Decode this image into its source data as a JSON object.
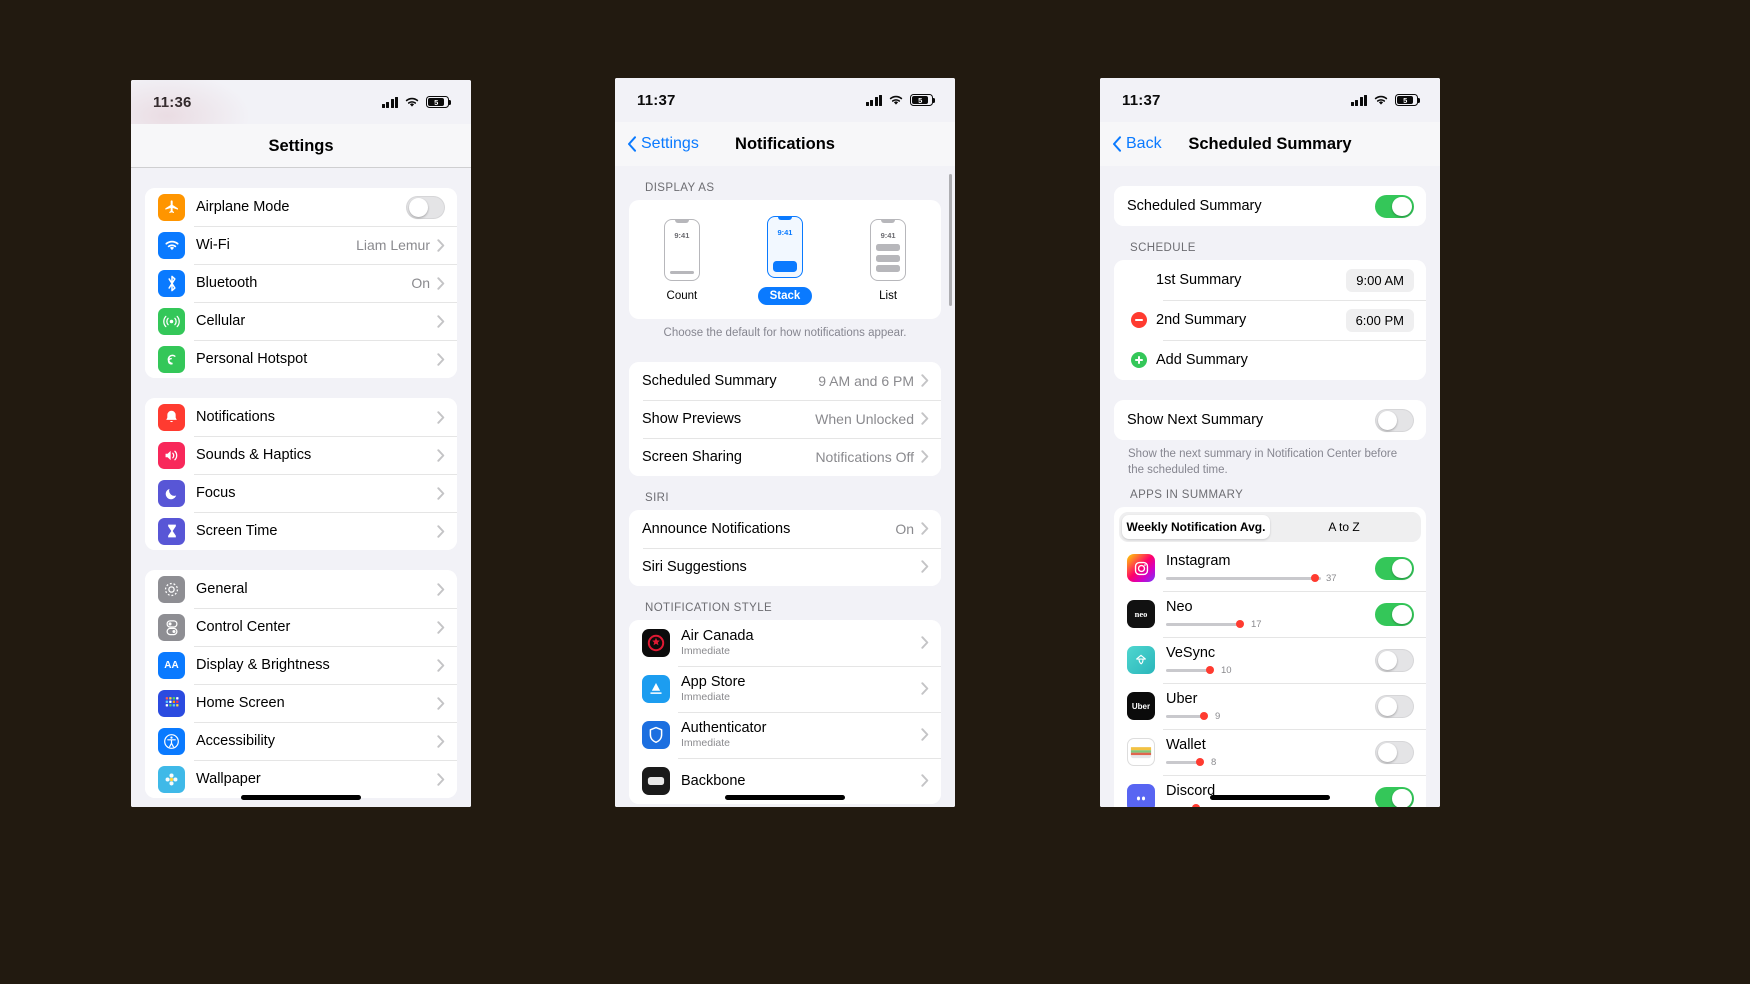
{
  "screens": {
    "settings": {
      "status": {
        "time": "11:36",
        "battery": "5"
      },
      "title": "Settings",
      "groups": [
        {
          "rows": [
            {
              "label": "Airplane Mode",
              "icon": "airplane-icon",
              "color": "#ff9500",
              "control": "toggle",
              "toggle_on": false
            },
            {
              "label": "Wi-Fi",
              "icon": "wifi-icon",
              "color": "#0a7aff",
              "value": "Liam Lemur",
              "control": "chevron"
            },
            {
              "label": "Bluetooth",
              "icon": "bluetooth-icon",
              "color": "#0a7aff",
              "value": "On",
              "control": "chevron"
            },
            {
              "label": "Cellular",
              "icon": "cellular-icon",
              "color": "#34c759",
              "value": "",
              "control": "chevron"
            },
            {
              "label": "Personal Hotspot",
              "icon": "hotspot-icon",
              "color": "#34c759",
              "value": "",
              "control": "chevron"
            }
          ]
        },
        {
          "rows": [
            {
              "label": "Notifications",
              "icon": "notifications-bell-icon",
              "color": "#ff3b30",
              "value": "",
              "control": "chevron"
            },
            {
              "label": "Sounds & Haptics",
              "icon": "sounds-speaker-icon",
              "color": "#f8285a",
              "value": "",
              "control": "chevron"
            },
            {
              "label": "Focus",
              "icon": "focus-moon-icon",
              "color": "#5856d6",
              "value": "",
              "control": "chevron"
            },
            {
              "label": "Screen Time",
              "icon": "screen-time-hourglass-icon",
              "color": "#5856d6",
              "value": "",
              "control": "chevron"
            }
          ]
        },
        {
          "rows": [
            {
              "label": "General",
              "icon": "general-gear-icon",
              "color": "#8e8e93",
              "value": "",
              "control": "chevron"
            },
            {
              "label": "Control Center",
              "icon": "control-center-icon",
              "color": "#8e8e93",
              "value": "",
              "control": "chevron"
            },
            {
              "label": "Display & Brightness",
              "icon": "display-brightness-aa-icon",
              "color": "#0a7aff",
              "value": "",
              "control": "chevron"
            },
            {
              "label": "Home Screen",
              "icon": "home-screen-grid-icon",
              "color": "#2b4be0",
              "value": "",
              "control": "chevron"
            },
            {
              "label": "Accessibility",
              "icon": "accessibility-icon",
              "color": "#0a7aff",
              "value": "",
              "control": "chevron"
            },
            {
              "label": "Wallpaper",
              "icon": "wallpaper-flower-icon",
              "color": "#3fb9e8",
              "value": "",
              "control": "chevron"
            }
          ]
        }
      ]
    },
    "notifications": {
      "status": {
        "time": "11:37",
        "battery": "5"
      },
      "back_label": "Settings",
      "title": "Notifications",
      "display_as": {
        "header": "DISPLAY AS",
        "footer": "Choose the default for how notifications appear.",
        "options": [
          {
            "label": "Count",
            "mini_time": "9:41",
            "selected": false
          },
          {
            "label": "Stack",
            "mini_time": "9:41",
            "selected": true
          },
          {
            "label": "List",
            "mini_time": "9:41",
            "selected": false
          }
        ]
      },
      "main_rows": [
        {
          "label": "Scheduled Summary",
          "value": "9 AM and 6 PM"
        },
        {
          "label": "Show Previews",
          "value": "When Unlocked"
        },
        {
          "label": "Screen Sharing",
          "value": "Notifications Off"
        }
      ],
      "siri": {
        "header": "SIRI",
        "rows": [
          {
            "label": "Announce Notifications",
            "value": "On"
          },
          {
            "label": "Siri Suggestions",
            "value": ""
          }
        ]
      },
      "notification_style": {
        "header": "NOTIFICATION STYLE",
        "apps": [
          {
            "name": "Air Canada",
            "sub": "Immediate",
            "icon": "air-canada-icon"
          },
          {
            "name": "App Store",
            "sub": "Immediate",
            "icon": "app-store-icon"
          },
          {
            "name": "Authenticator",
            "sub": "Immediate",
            "icon": "authenticator-icon"
          },
          {
            "name": "Backbone",
            "sub": "",
            "icon": "backbone-icon"
          }
        ]
      }
    },
    "scheduled_summary": {
      "status": {
        "time": "11:37",
        "battery": "5"
      },
      "back_label": "Back",
      "title": "Scheduled Summary",
      "master_row": {
        "label": "Scheduled Summary",
        "toggle_on": true
      },
      "schedule": {
        "header": "SCHEDULE",
        "rows": [
          {
            "label": "1st Summary",
            "time": "9:00 AM",
            "action": "none"
          },
          {
            "label": "2nd Summary",
            "time": "6:00 PM",
            "action": "remove"
          },
          {
            "label": "Add Summary",
            "time": "",
            "action": "add"
          }
        ]
      },
      "show_next": {
        "label": "Show Next Summary",
        "toggle_on": false,
        "footer": "Show the next summary in Notification Center before the scheduled time."
      },
      "apps_in_summary": {
        "header": "APPS IN SUMMARY",
        "segments": [
          {
            "label": "Weekly Notification Avg.",
            "active": true
          },
          {
            "label": "A to Z",
            "active": false
          }
        ],
        "apps": [
          {
            "name": "Instagram",
            "count": "37",
            "fill": 0.93,
            "toggle_on": true,
            "icon": "instagram-icon"
          },
          {
            "name": "Neo",
            "count": "17",
            "fill": 0.6,
            "toggle_on": true,
            "icon": "neo-icon"
          },
          {
            "name": "VeSync",
            "count": "10",
            "fill": 0.37,
            "toggle_on": false,
            "icon": "vesync-icon"
          },
          {
            "name": "Uber",
            "count": "9",
            "fill": 0.32,
            "toggle_on": false,
            "icon": "uber-icon"
          },
          {
            "name": "Wallet",
            "count": "8",
            "fill": 0.29,
            "toggle_on": false,
            "icon": "wallet-icon"
          },
          {
            "name": "Discord",
            "count": "",
            "fill": 0.26,
            "toggle_on": true,
            "icon": "discord-icon"
          }
        ]
      }
    }
  }
}
